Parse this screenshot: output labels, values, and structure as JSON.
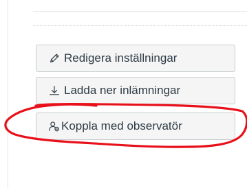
{
  "sidebar_actions": {
    "edit_settings": {
      "label": "Redigera inställningar",
      "icon": "pencil-icon"
    },
    "download_submissions": {
      "label": "Ladda ner inlämningar",
      "icon": "download-icon"
    },
    "link_observer": {
      "label": "Koppla med observatör",
      "icon": "observer-icon"
    }
  },
  "colors": {
    "button_bg": "#f5f5f5",
    "button_border": "#c7cdd1",
    "text": "#2d3b45",
    "annotation_red": "#e8101a"
  }
}
